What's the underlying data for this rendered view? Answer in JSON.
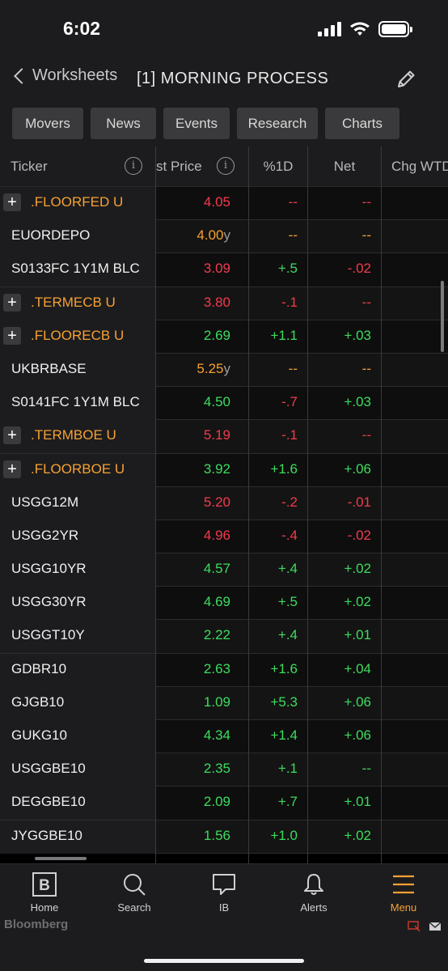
{
  "status_bar": {
    "time": "6:02"
  },
  "nav": {
    "back_label": "Worksheets",
    "title": "[1] MORNING PROCESS"
  },
  "tabs": [
    "Movers",
    "News",
    "Events",
    "Research",
    "Charts"
  ],
  "table": {
    "headers": {
      "ticker": "Ticker",
      "price": "st Price",
      "pct": "%1D",
      "net": "Net",
      "wtd": "Chg WTD"
    },
    "rows": [
      {
        "expand": "+",
        "ticker": ".FLOORFED U",
        "group": true,
        "price": "4.05",
        "price_suffix": "",
        "price_color": "red",
        "pct": "--",
        "pct_color": "red",
        "net": "--",
        "net_color": "red"
      },
      {
        "expand": "",
        "ticker": "EUORDEPO",
        "group": false,
        "price": "4.00",
        "price_suffix": "y",
        "price_color": "orange",
        "pct": "--",
        "pct_color": "orange",
        "net": "--",
        "net_color": "orange"
      },
      {
        "expand": "",
        "ticker": "S0133FC 1Y1M BLC",
        "group": false,
        "price": "3.09",
        "price_suffix": "",
        "price_color": "red",
        "pct": "+.5",
        "pct_color": "green",
        "net": "-.02",
        "net_color": "red"
      },
      {
        "expand": "+",
        "ticker": ".TERMECB U",
        "group": true,
        "price": "3.80",
        "price_suffix": "",
        "price_color": "red",
        "pct": "-.1",
        "pct_color": "red",
        "net": "--",
        "net_color": "red"
      },
      {
        "expand": "+",
        "ticker": ".FLOORECB U",
        "group": true,
        "price": "2.69",
        "price_suffix": "",
        "price_color": "green",
        "pct": "+1.1",
        "pct_color": "green",
        "net": "+.03",
        "net_color": "green"
      },
      {
        "expand": "",
        "ticker": "UKBRBASE",
        "group": false,
        "price": "5.25",
        "price_suffix": "y",
        "price_color": "orange",
        "pct": "--",
        "pct_color": "orange",
        "net": "--",
        "net_color": "orange"
      },
      {
        "expand": "",
        "ticker": "S0141FC 1Y1M BLC",
        "group": false,
        "price": "4.50",
        "price_suffix": "",
        "price_color": "green",
        "pct": "-.7",
        "pct_color": "red",
        "net": "+.03",
        "net_color": "green"
      },
      {
        "expand": "+",
        "ticker": ".TERMBOE U",
        "group": true,
        "price": "5.19",
        "price_suffix": "",
        "price_color": "red",
        "pct": "-.1",
        "pct_color": "red",
        "net": "--",
        "net_color": "red"
      },
      {
        "expand": "+",
        "ticker": ".FLOORBOE U",
        "group": true,
        "price": "3.92",
        "price_suffix": "",
        "price_color": "green",
        "pct": "+1.6",
        "pct_color": "green",
        "net": "+.06",
        "net_color": "green"
      },
      {
        "expand": "",
        "ticker": "USGG12M",
        "group": false,
        "price": "5.20",
        "price_suffix": "",
        "price_color": "red",
        "pct": "-.2",
        "pct_color": "red",
        "net": "-.01",
        "net_color": "red"
      },
      {
        "expand": "",
        "ticker": "USGG2YR",
        "group": false,
        "price": "4.96",
        "price_suffix": "",
        "price_color": "red",
        "pct": "-.4",
        "pct_color": "red",
        "net": "-.02",
        "net_color": "red"
      },
      {
        "expand": "",
        "ticker": "USGG10YR",
        "group": false,
        "price": "4.57",
        "price_suffix": "",
        "price_color": "green",
        "pct": "+.4",
        "pct_color": "green",
        "net": "+.02",
        "net_color": "green"
      },
      {
        "expand": "",
        "ticker": "USGG30YR",
        "group": false,
        "price": "4.69",
        "price_suffix": "",
        "price_color": "green",
        "pct": "+.5",
        "pct_color": "green",
        "net": "+.02",
        "net_color": "green"
      },
      {
        "expand": "",
        "ticker": "USGGT10Y",
        "group": false,
        "price": "2.22",
        "price_suffix": "",
        "price_color": "green",
        "pct": "+.4",
        "pct_color": "green",
        "net": "+.01",
        "net_color": "green"
      },
      {
        "expand": "",
        "ticker": "GDBR10",
        "group": false,
        "price": "2.63",
        "price_suffix": "",
        "price_color": "green",
        "pct": "+1.6",
        "pct_color": "green",
        "net": "+.04",
        "net_color": "green"
      },
      {
        "expand": "",
        "ticker": "GJGB10",
        "group": false,
        "price": "1.09",
        "price_suffix": "",
        "price_color": "green",
        "pct": "+5.3",
        "pct_color": "green",
        "net": "+.06",
        "net_color": "green"
      },
      {
        "expand": "",
        "ticker": "GUKG10",
        "group": false,
        "price": "4.34",
        "price_suffix": "",
        "price_color": "green",
        "pct": "+1.4",
        "pct_color": "green",
        "net": "+.06",
        "net_color": "green"
      },
      {
        "expand": "",
        "ticker": "USGGBE10",
        "group": false,
        "price": "2.35",
        "price_suffix": "",
        "price_color": "green",
        "pct": "+.1",
        "pct_color": "green",
        "net": "--",
        "net_color": "green"
      },
      {
        "expand": "",
        "ticker": "DEGGBE10",
        "group": false,
        "price": "2.09",
        "price_suffix": "",
        "price_color": "green",
        "pct": "+.7",
        "pct_color": "green",
        "net": "+.01",
        "net_color": "green"
      },
      {
        "expand": "",
        "ticker": "JYGGBE10",
        "group": false,
        "price": "1.56",
        "price_suffix": "",
        "price_color": "green",
        "pct": "+1.0",
        "pct_color": "green",
        "net": "+.02",
        "net_color": "green"
      }
    ]
  },
  "bottom_bar": {
    "items": [
      {
        "label": "Home",
        "icon": "bloomberg-b-icon"
      },
      {
        "label": "Search",
        "icon": "search-icon"
      },
      {
        "label": "IB",
        "icon": "chat-bubble-icon"
      },
      {
        "label": "Alerts",
        "icon": "bell-icon"
      },
      {
        "label": "Menu",
        "icon": "hamburger-menu-icon"
      }
    ],
    "active": "Menu",
    "brand": "Bloomberg"
  },
  "colors": {
    "red": "#f23b4c",
    "green": "#3ddc5e",
    "orange": "#f7a133",
    "background": "#1c1c1e"
  }
}
